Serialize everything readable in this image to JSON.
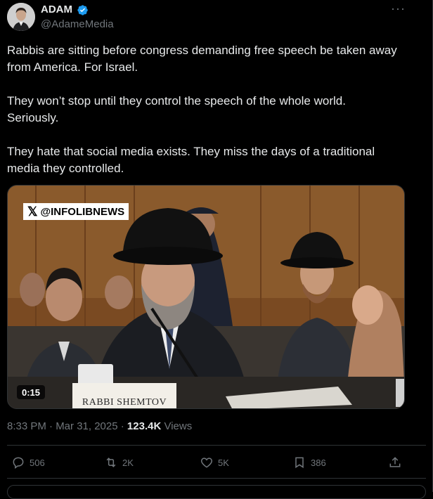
{
  "post": {
    "author_name": "ADAM",
    "author_handle": "@AdameMedia",
    "more_label": "···",
    "text": "Rabbis are sitting before congress demanding free speech be taken away from America. For Israel.\n\nThey won’t stop until they control the speech of the whole world. Seriously.\n\nThey hate that social media exists. They miss the days of a traditional media they controlled.",
    "media": {
      "watermark": "@INFOLIBNEWS",
      "watermark_logo": "𝕏",
      "duration": "0:15",
      "nameplate": "RABBI SHEMTOV"
    },
    "timestamp": "8:33 PM · Mar 31, 2025 · ",
    "views_count": "123.4K",
    "views_label": " Views"
  },
  "actions": {
    "replies": "506",
    "reposts": "2K",
    "likes": "5K",
    "bookmarks": "386"
  },
  "colors": {
    "background": "#000000",
    "text": "#e7e9ea",
    "muted": "#71767b",
    "verified": "#1d9bf0",
    "border": "#2f3336"
  },
  "icons": [
    "verified-badge-icon",
    "more-icon",
    "reply-icon",
    "repost-icon",
    "like-icon",
    "bookmark-icon",
    "share-icon"
  ]
}
